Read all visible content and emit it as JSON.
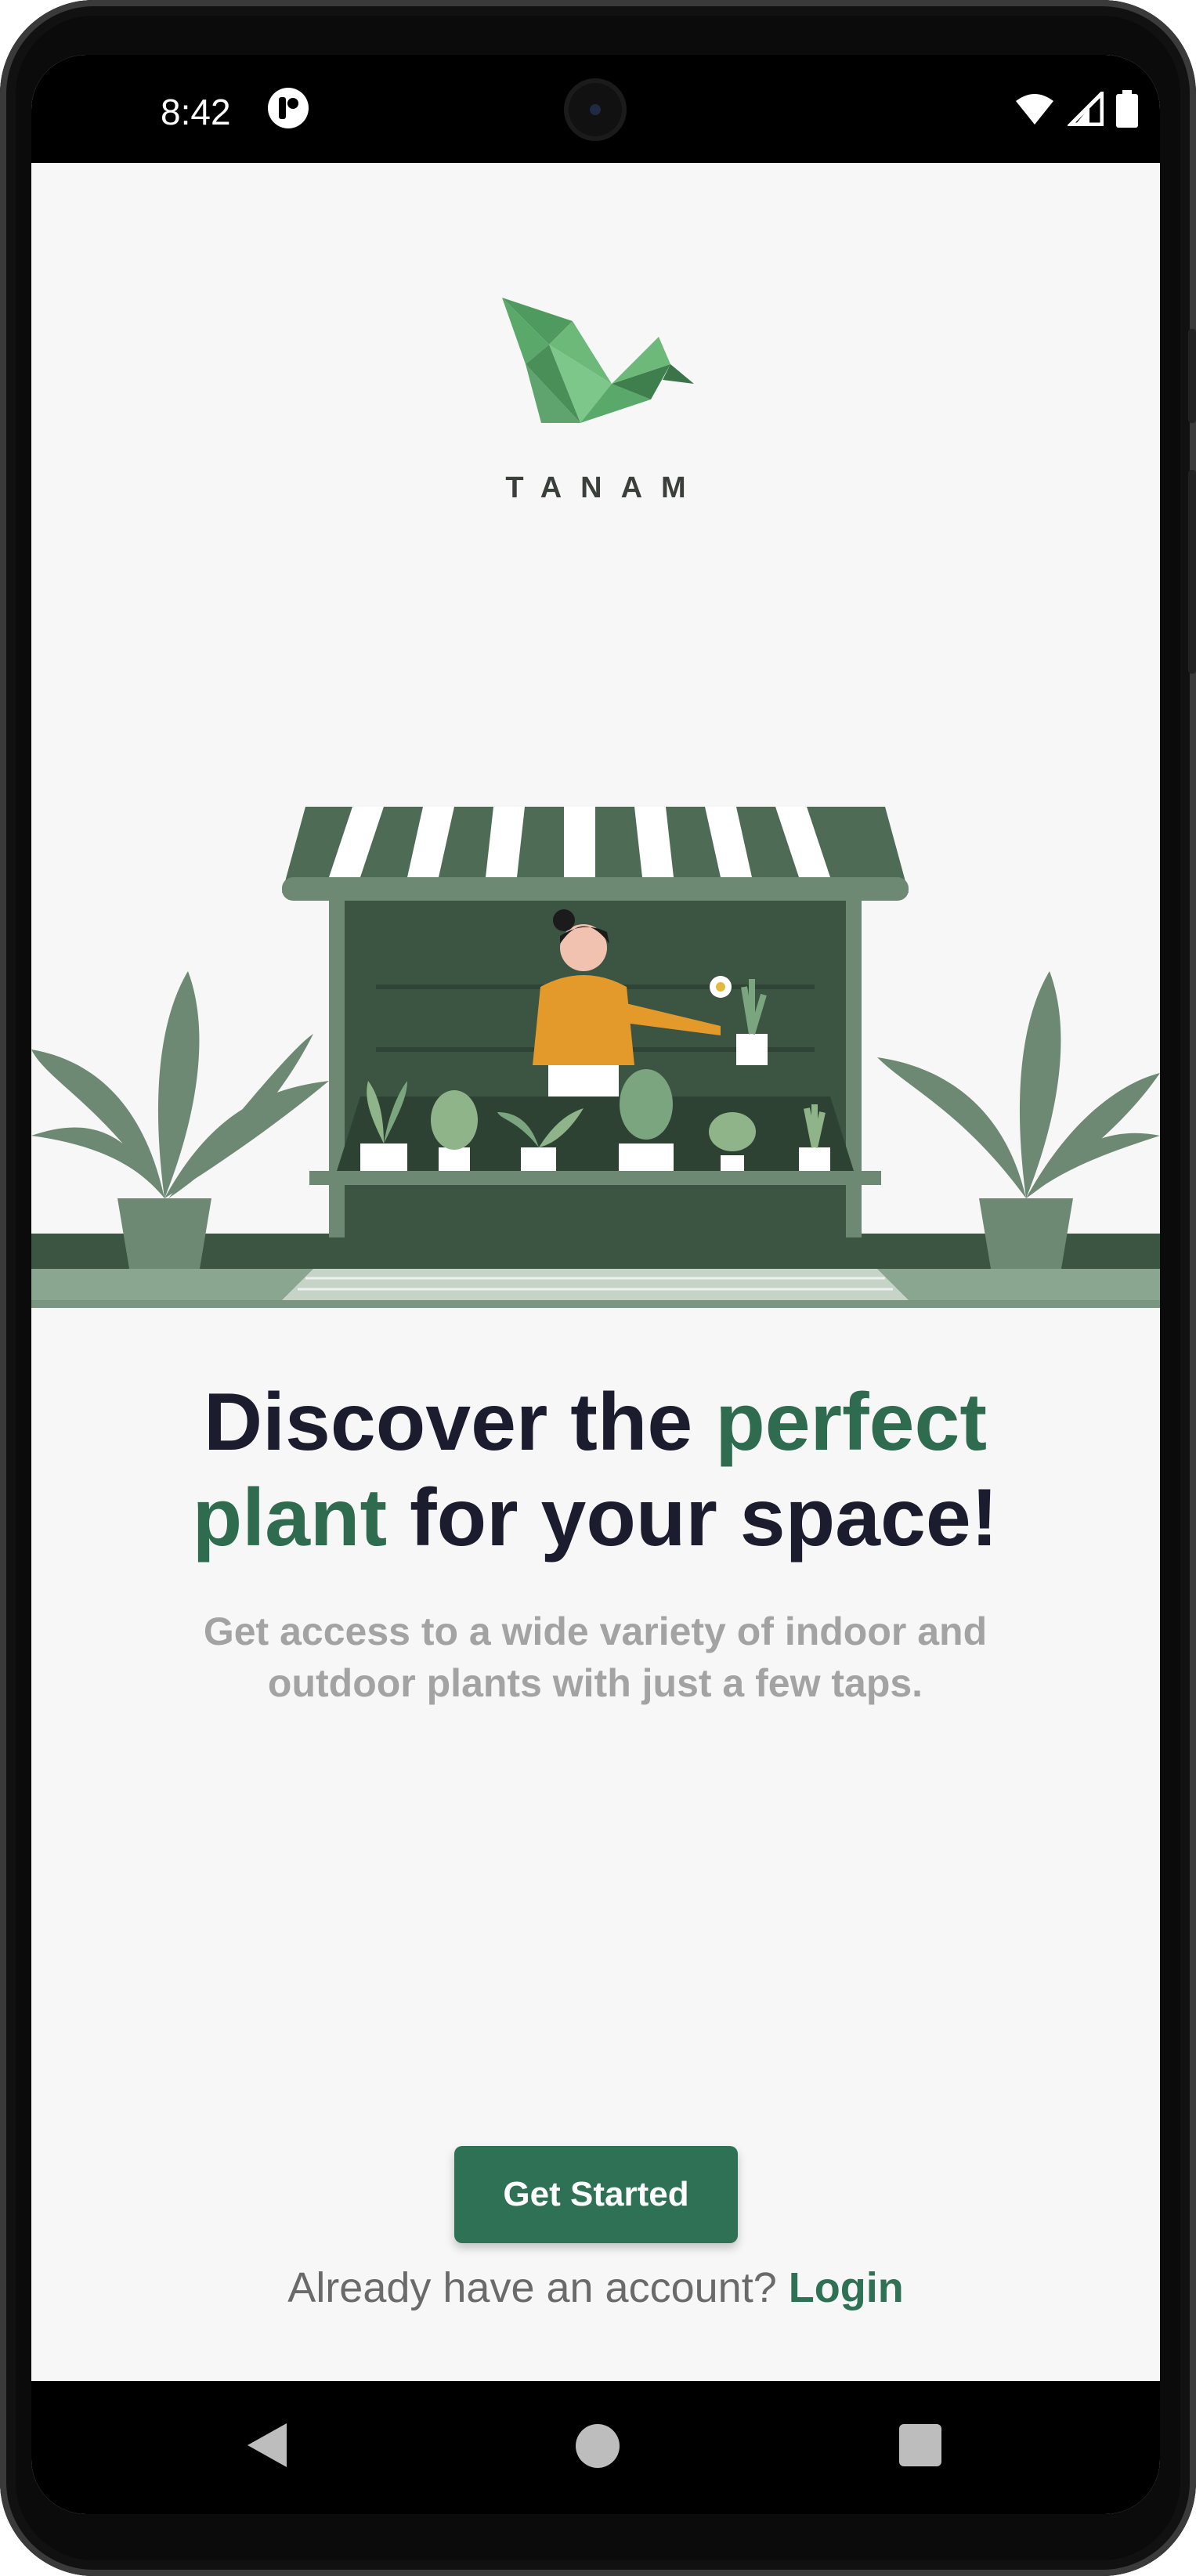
{
  "status_bar": {
    "time": "8:42",
    "app_icon": "tanam-app-icon",
    "icons": [
      "wifi-icon",
      "cellular-signal-icon",
      "battery-icon"
    ]
  },
  "logo": {
    "name": "TANAM",
    "icon": "origami-bird-logo",
    "color": "#5fa36f"
  },
  "hero": {
    "headline_part1": "Discover the",
    "headline_accent": "perfect plant",
    "headline_part2": "for your space!",
    "subtext": "Get access to a wide variety of indoor and outdoor plants with just a few taps."
  },
  "actions": {
    "get_started_label": "Get Started",
    "login_prompt": "Already have an account?",
    "login_label": "Login"
  },
  "colors": {
    "accent": "#2f7155",
    "headline": "#1b1d2e",
    "subtext": "#a3a3a3",
    "background": "#f7f7f7"
  },
  "nav_bar": {
    "icons": [
      "back-icon",
      "home-icon",
      "recents-icon"
    ]
  }
}
